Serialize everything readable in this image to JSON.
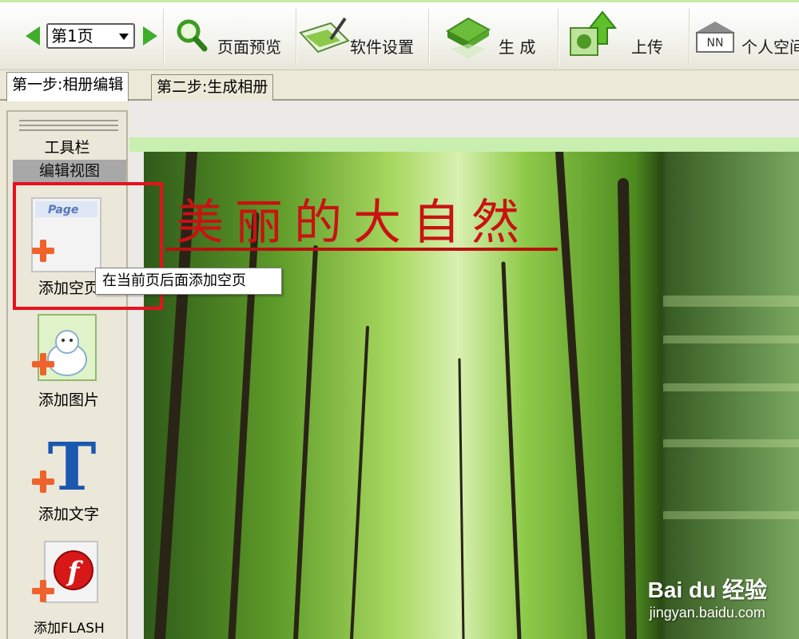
{
  "toolbar": {
    "page_select": "第1页",
    "buttons": [
      {
        "label": "页面预览",
        "icon": "magnifier-icon"
      },
      {
        "label": "软件设置",
        "icon": "settings-pen-icon"
      },
      {
        "label": "生 成",
        "icon": "generate-book-icon"
      },
      {
        "label": "上传",
        "icon": "upload-arrow-icon"
      },
      {
        "label": "个人空间",
        "icon": "personal-space-icon"
      }
    ]
  },
  "tabs": [
    {
      "label": "第一步:相册编辑",
      "active": true
    },
    {
      "label": "第二步:生成相册",
      "active": false
    }
  ],
  "sidebar": {
    "title": "工具栏",
    "view_label": "编辑视图",
    "tools": [
      {
        "label": "添加空页",
        "icon": "blank-page-icon",
        "icon_text": "Page"
      },
      {
        "label": "添加图片",
        "icon": "add-image-icon"
      },
      {
        "label": "添加文字",
        "icon": "add-text-icon",
        "icon_text": "T"
      },
      {
        "label": "添加FLASH",
        "icon": "add-flash-icon",
        "icon_text": "f"
      }
    ]
  },
  "tooltip": "在当前页后面添加空页",
  "canvas": {
    "page_title": "美丽的大自然"
  },
  "watermark": {
    "logo": "Bai du 经验",
    "url": "jingyan.baidu.com"
  },
  "colors": {
    "accent_green": "#3fae2a",
    "highlight_red": "#e8101e",
    "title_red": "#c91212"
  }
}
